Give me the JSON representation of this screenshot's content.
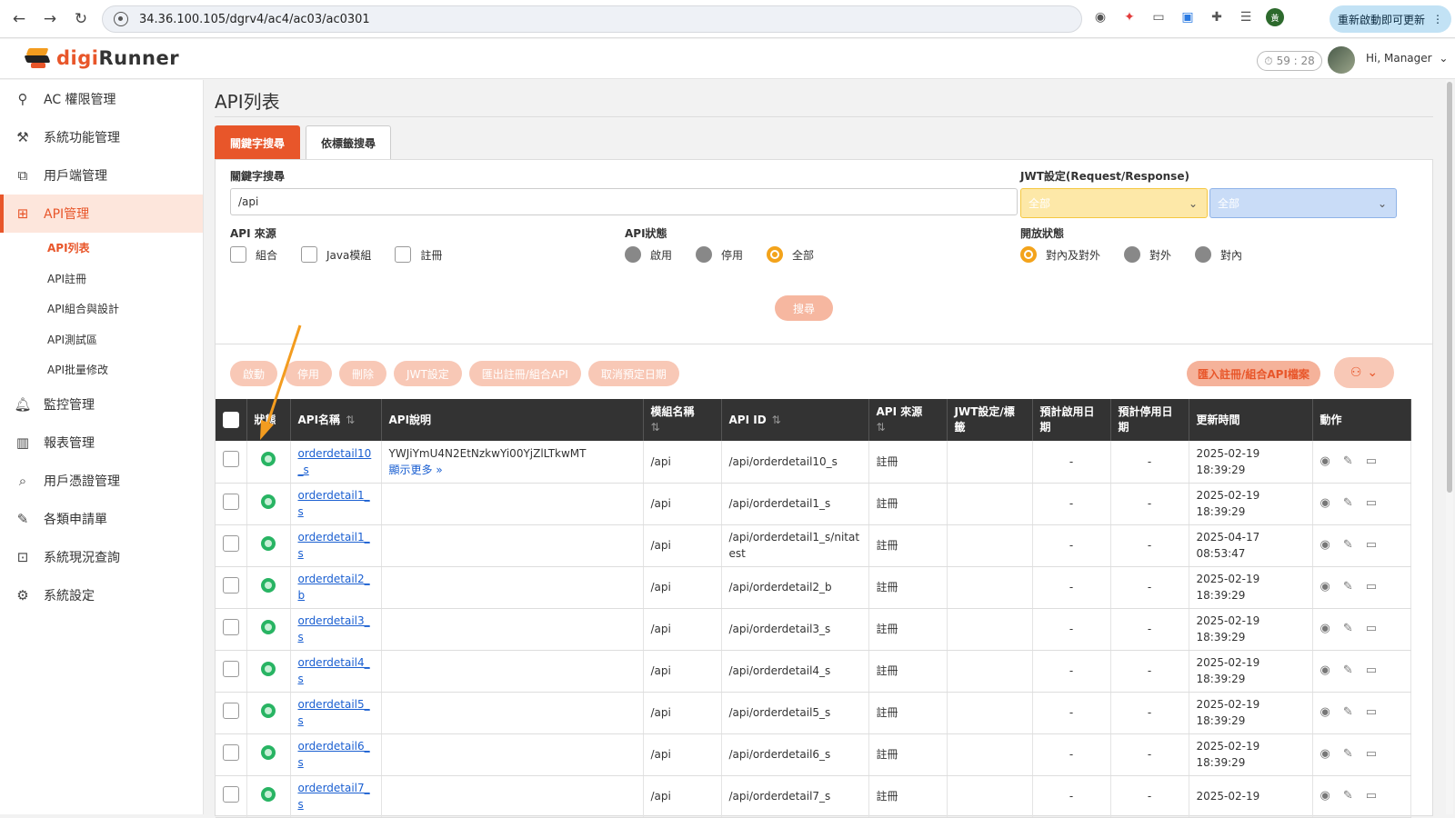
{
  "browser": {
    "url": "34.36.100.105/dgrv4/ac4/ac03/ac0301",
    "update_label": "重新啟動即可更新",
    "profile_initial": "黃"
  },
  "header": {
    "logo_prefix": "digi",
    "logo_suffix": "Runner",
    "timer": "59 : 28",
    "greeting": "Hi, Manager"
  },
  "sidebar": {
    "items": [
      {
        "label": "AC 權限管理",
        "icon": "user-key-icon"
      },
      {
        "label": "系統功能管理",
        "icon": "tools-icon"
      },
      {
        "label": "用戶端管理",
        "icon": "client-network-icon"
      },
      {
        "label": "API管理",
        "icon": "api-management-icon"
      },
      {
        "label": "監控管理",
        "icon": "bell-icon"
      },
      {
        "label": "報表管理",
        "icon": "bar-chart-icon"
      },
      {
        "label": "用戶憑證管理",
        "icon": "search-icon"
      },
      {
        "label": "各類申請單",
        "icon": "edit-form-icon"
      },
      {
        "label": "系統現況查詢",
        "icon": "lock-icon"
      },
      {
        "label": "系統設定",
        "icon": "gear-icon"
      }
    ],
    "subitems": [
      "API列表",
      "API註冊",
      "API組合與設計",
      "API測試區",
      "API批量修改"
    ]
  },
  "page": {
    "title": "API列表",
    "tabs": [
      "關鍵字搜尋",
      "依標籤搜尋"
    ]
  },
  "search": {
    "keyword_label": "關鍵字搜尋",
    "keyword_value": "/api",
    "jwt_label": "JWT設定(Request/Response)",
    "jwt_request": "全部",
    "jwt_response": "全部",
    "source_label": "API 來源",
    "source_options": [
      "組合",
      "Java模組",
      "註冊"
    ],
    "status_label": "API狀態",
    "status_options": [
      "啟用",
      "停用",
      "全部"
    ],
    "open_label": "開放狀態",
    "open_options": [
      "對內及對外",
      "對外",
      "對內"
    ],
    "search_button": "搜尋"
  },
  "actions": {
    "buttons": [
      "啟動",
      "停用",
      "刪除",
      "JWT設定",
      "匯出註冊/組合API",
      "取消預定日期"
    ],
    "import_button": "匯入註冊/組合API檔案"
  },
  "table": {
    "headers": {
      "status": "狀態",
      "api_name": "API名稱",
      "api_desc": "API說明",
      "module": "模組名稱",
      "api_id": "API ID",
      "source": "API 來源",
      "jwt": "JWT設定/標籤",
      "start_date": "預計啟用日期",
      "end_date": "預計停用日期",
      "updated": "更新時間",
      "actions": "動作"
    },
    "show_more": "顯示更多 »",
    "rows": [
      {
        "name": "orderdetail10_s",
        "desc": "YWJiYmU4N2EtNzkwYi00YjZlLTkwMT",
        "module": "/api",
        "id": "/api/orderdetail10_s",
        "source": "註冊",
        "start": "-",
        "end": "-",
        "date": "2025-02-19",
        "time": "18:39:29"
      },
      {
        "name": "orderdetail1_s",
        "desc": "",
        "module": "/api",
        "id": "/api/orderdetail1_s",
        "source": "註冊",
        "start": "-",
        "end": "-",
        "date": "2025-02-19",
        "time": "18:39:29"
      },
      {
        "name": "orderdetail1_s",
        "desc": "",
        "module": "/api",
        "id": "/api/orderdetail1_s/nitatest",
        "source": "註冊",
        "start": "-",
        "end": "-",
        "date": "2025-04-17",
        "time": "08:53:47"
      },
      {
        "name": "orderdetail2_b",
        "desc": "",
        "module": "/api",
        "id": "/api/orderdetail2_b",
        "source": "註冊",
        "start": "-",
        "end": "-",
        "date": "2025-02-19",
        "time": "18:39:29"
      },
      {
        "name": "orderdetail3_s",
        "desc": "",
        "module": "/api",
        "id": "/api/orderdetail3_s",
        "source": "註冊",
        "start": "-",
        "end": "-",
        "date": "2025-02-19",
        "time": "18:39:29"
      },
      {
        "name": "orderdetail4_s",
        "desc": "",
        "module": "/api",
        "id": "/api/orderdetail4_s",
        "source": "註冊",
        "start": "-",
        "end": "-",
        "date": "2025-02-19",
        "time": "18:39:29"
      },
      {
        "name": "orderdetail5_s",
        "desc": "",
        "module": "/api",
        "id": "/api/orderdetail5_s",
        "source": "註冊",
        "start": "-",
        "end": "-",
        "date": "2025-02-19",
        "time": "18:39:29"
      },
      {
        "name": "orderdetail6_s",
        "desc": "",
        "module": "/api",
        "id": "/api/orderdetail6_s",
        "source": "註冊",
        "start": "-",
        "end": "-",
        "date": "2025-02-19",
        "time": "18:39:29"
      },
      {
        "name": "orderdetail7_s",
        "desc": "",
        "module": "/api",
        "id": "/api/orderdetail7_s",
        "source": "註冊",
        "start": "-",
        "end": "-",
        "date": "2025-02-19",
        "time": ""
      }
    ]
  },
  "colors": {
    "accent": "#e8562a",
    "active_status": "#28b463",
    "annotation_arrow": "#f39c1f"
  }
}
